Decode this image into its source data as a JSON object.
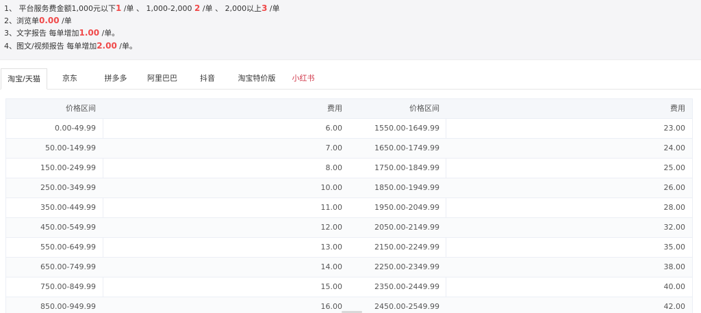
{
  "notes": [
    {
      "prefix": "1、 平台服务费金额1,000元以下",
      "h1": "1",
      "mid1": " /单 、 1,000-2,000 ",
      "h2": "2",
      "mid2": " /单 、 2,000以上",
      "h3": "3",
      "suffix": " /单"
    },
    {
      "prefix": "2、浏览单",
      "h1": "0.00",
      "suffix": " /单"
    },
    {
      "prefix": "3、文字报告 每单增加",
      "h1": "1.00",
      "suffix": " /单。"
    },
    {
      "prefix": "4、图文/视频报告 每单增加",
      "h1": "2.00",
      "suffix": " /单。"
    }
  ],
  "tabs": [
    "淘宝/天猫",
    "京东",
    "拼多多",
    "阿里巴巴",
    "抖音",
    "淘宝特价版",
    "小红书"
  ],
  "active_tab": "淘宝/天猫",
  "colors": {
    "highlight": "#f04a4a",
    "tab_red": "#d0384a"
  },
  "table": {
    "headers": [
      "价格区间",
      "费用",
      "价格区间",
      "费用"
    ],
    "rows": [
      [
        "0.00-49.99",
        "6.00",
        "1550.00-1649.99",
        "23.00"
      ],
      [
        "50.00-149.99",
        "7.00",
        "1650.00-1749.99",
        "24.00"
      ],
      [
        "150.00-249.99",
        "8.00",
        "1750.00-1849.99",
        "25.00"
      ],
      [
        "250.00-349.99",
        "10.00",
        "1850.00-1949.99",
        "26.00"
      ],
      [
        "350.00-449.99",
        "11.00",
        "1950.00-2049.99",
        "28.00"
      ],
      [
        "450.00-549.99",
        "12.00",
        "2050.00-2149.99",
        "32.00"
      ],
      [
        "550.00-649.99",
        "13.00",
        "2150.00-2249.99",
        "35.00"
      ],
      [
        "650.00-749.99",
        "14.00",
        "2250.00-2349.99",
        "38.00"
      ],
      [
        "750.00-849.99",
        "15.00",
        "2350.00-2449.99",
        "40.00"
      ],
      [
        "850.00-949.99",
        "16.00",
        "2450.00-2549.99",
        "42.00"
      ]
    ]
  }
}
